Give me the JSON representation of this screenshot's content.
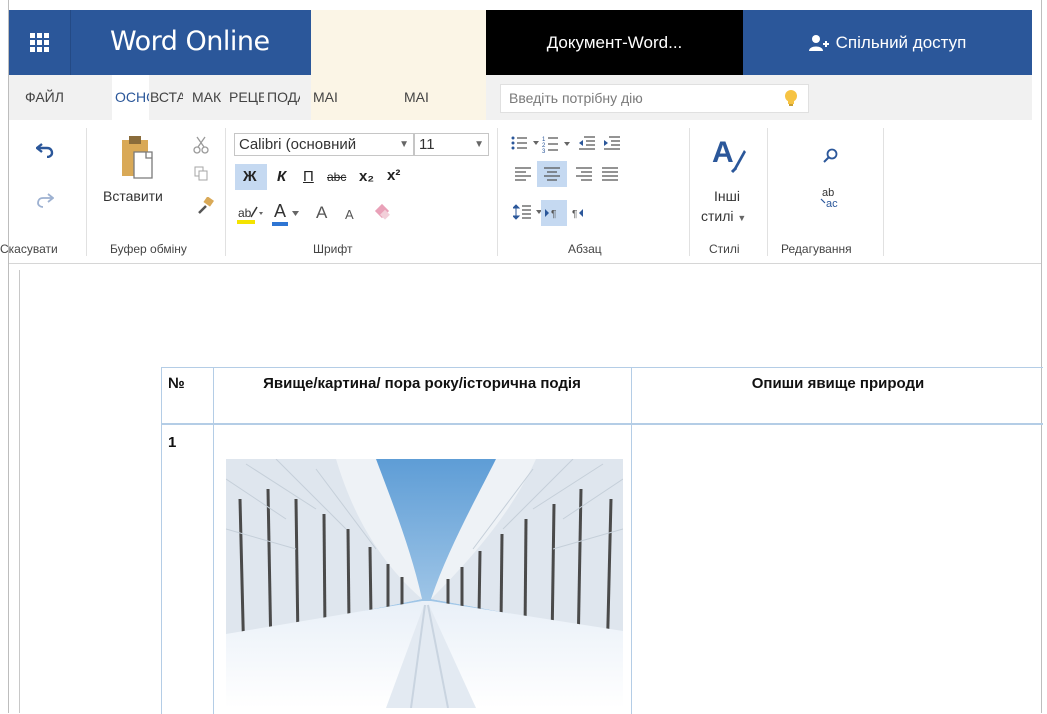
{
  "titlebar": {
    "app_name": "Word Online",
    "document_title": "Документ-Word...",
    "share_label": "Спільний доступ"
  },
  "tabs": [
    {
      "label": "ФАЙЛ"
    },
    {
      "label": "ОСНОВНЕ"
    },
    {
      "label": "ВСТАВЛЕННЯ"
    },
    {
      "label": "МАКЕТ"
    },
    {
      "label": "РЕЦЕНЗУВАННЯ"
    },
    {
      "label": "ПОДАННЯ"
    },
    {
      "label": "МАІ"
    },
    {
      "label": "МАІ"
    }
  ],
  "tell_me": {
    "placeholder": "Введіть потрібну дію"
  },
  "ribbon": {
    "undo_group": {
      "label": "Скасувати"
    },
    "clipboard": {
      "paste_label": "Вставити",
      "label": "Буфер обміну"
    },
    "font": {
      "name": "Calibri (основний",
      "size": "11",
      "label": "Шрифт",
      "bold": "Ж",
      "italic": "К",
      "underline": "П",
      "strike": "abc",
      "sub": "x₂",
      "sup": "x²",
      "grow": "A",
      "shrink": "A",
      "font_color": "A"
    },
    "paragraph": {
      "label": "Абзац"
    },
    "styles": {
      "button_label_1": "Інші",
      "button_label_2": "стилі",
      "label": "Стилі"
    },
    "editing": {
      "label": "Редагування"
    }
  },
  "table": {
    "headers": [
      "№",
      "Явище/картина/ пора року/історична подія",
      "Опиши явище природи"
    ],
    "rows": [
      {
        "number": "1",
        "image": "winter-birch-alley-photo",
        "description": ""
      }
    ]
  },
  "colors": {
    "accent": "#2b579a",
    "ribbon_selected": "#c5d9f1",
    "table_border": "#b4cde6"
  },
  "icons": [
    "apps-grid-icon",
    "share-person-icon",
    "lightbulb-icon",
    "undo-icon",
    "redo-icon",
    "paste-icon",
    "cut-icon",
    "copy-icon",
    "format-painter-icon",
    "bullets-icon",
    "numbering-icon",
    "styles-icon",
    "find-icon",
    "replace-icon"
  ]
}
